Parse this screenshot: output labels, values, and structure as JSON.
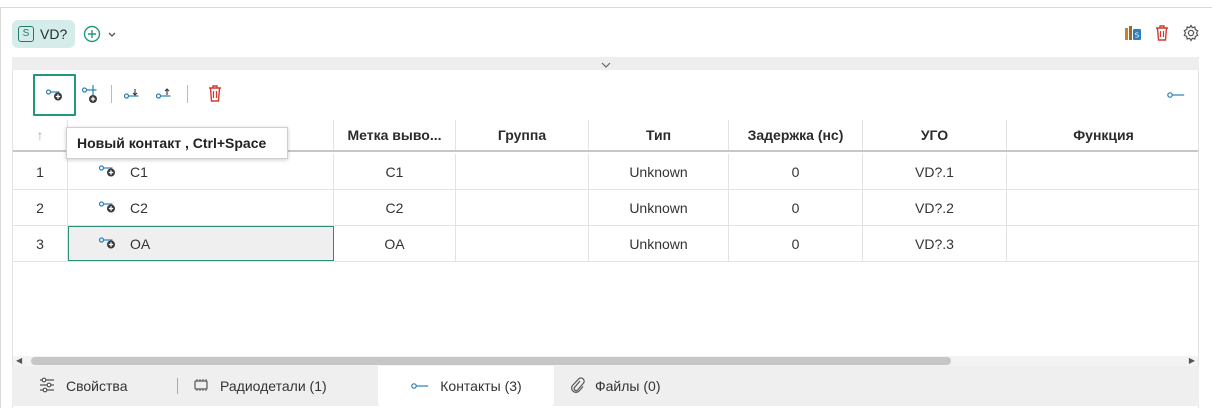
{
  "component": {
    "badge": "S",
    "name": "VD?"
  },
  "toolbar": {
    "tooltip": "Новый контакт , Ctrl+Space"
  },
  "table": {
    "sort_arrow": "↑",
    "columns": [
      "Метка выво...",
      "Группа",
      "Тип",
      "Задержка (нс)",
      "УГО",
      "Функция"
    ],
    "rows": [
      {
        "num": "1",
        "name": "C1",
        "label": "C1",
        "group": "",
        "type": "Unknown",
        "delay": "0",
        "ugo": "VD?.1",
        "func": ""
      },
      {
        "num": "2",
        "name": "C2",
        "label": "C2",
        "group": "",
        "type": "Unknown",
        "delay": "0",
        "ugo": "VD?.2",
        "func": ""
      },
      {
        "num": "3",
        "name": "OA",
        "label": "OA",
        "group": "",
        "type": "Unknown",
        "delay": "0",
        "ugo": "VD?.3",
        "func": ""
      }
    ]
  },
  "tabs": {
    "properties": "Свойства",
    "parts": "Радиодетали (1)",
    "contacts": "Контакты (3)",
    "files": "Файлы (0)"
  },
  "colors": {
    "accent": "#1e9a7b",
    "delete": "#d33a2f",
    "chip_bg": "#d6ecea"
  }
}
